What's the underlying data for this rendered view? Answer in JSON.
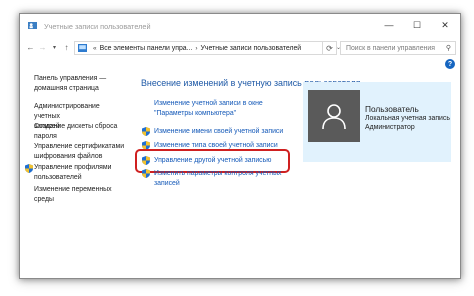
{
  "window": {
    "title": "Учетные записи пользователей",
    "controls": {
      "minimize": "—",
      "maximize": "☐",
      "close": "✕"
    }
  },
  "address_bar": {
    "breadcrumbs": [
      "Все элементы панели упра...",
      "Учетные записи пользователей"
    ],
    "separator": "›",
    "prefix_separator": "«",
    "search_placeholder": "Поиск в панели управления"
  },
  "nav_buttons": {
    "back": "←",
    "forward": "→",
    "recent": "▾",
    "up": "↑",
    "refresh": "⟳",
    "dropdown": "⌄"
  },
  "help": "?",
  "sidebar": {
    "items": [
      {
        "label_lines": [
          "Панель управления —",
          "домашняя страница"
        ],
        "shield": false
      },
      {
        "label_lines": [
          "Администрирование учетных",
          "записей"
        ],
        "shield": false
      },
      {
        "label_lines": [
          "Создание дискеты сброса",
          "пароля"
        ],
        "shield": false
      },
      {
        "label_lines": [
          "Управление сертификатами",
          "шифрования файлов"
        ],
        "shield": false
      },
      {
        "label_lines": [
          "Управление профилями",
          "пользователей"
        ],
        "shield": true
      },
      {
        "label_lines": [
          "Изменение переменных",
          "среды"
        ],
        "shield": false
      }
    ]
  },
  "main": {
    "heading": "Внесение изменений в учетную запись пользователя",
    "links": [
      {
        "label_lines": [
          "Изменение учетной записи в окне",
          "\"Параметры компьютера\""
        ],
        "shield": false
      },
      {
        "label_lines": [
          "Изменение имени своей учетной записи"
        ],
        "shield": true
      },
      {
        "label_lines": [
          "Изменение типа своей учетной записи"
        ],
        "shield": true
      },
      {
        "label_lines": [
          "Управление другой учетной записью"
        ],
        "shield": true,
        "highlighted": true
      },
      {
        "label_lines": [
          "Изменить параметры контроля учетных",
          "записей"
        ],
        "shield": true
      }
    ]
  },
  "user_card": {
    "name": "Пользователь",
    "account_type": "Локальная учетная запись",
    "role": "Администратор"
  },
  "colors": {
    "link": "#1459b8",
    "heading": "#1f5aa7",
    "highlight": "#cf2020",
    "user_card_bg": "#e1f2fd",
    "avatar_bg": "#5a5a5a"
  }
}
